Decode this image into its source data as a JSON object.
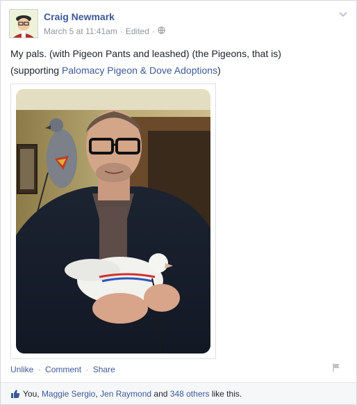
{
  "post": {
    "author": "Craig Newmark",
    "timestamp": "March 5 at 11:41am",
    "edited": "Edited",
    "meta_sep": "·",
    "line1": "My pals. (with Pigeon Pants and leashed) (the Pigeons, that is)",
    "line2_prefix": "(supporting ",
    "line2_link": "Palomacy Pigeon & Dove Adoptions",
    "line2_suffix": ")"
  },
  "actions": {
    "unlike": "Unlike",
    "comment": "Comment",
    "share": "Share",
    "sep": "·"
  },
  "likes": {
    "you": "You,",
    "name1": "Maggie Sergio",
    "sep": ",",
    "name2": "Jen Raymond",
    "and": "and",
    "others": "348 others",
    "tail": "like this."
  },
  "colors": {
    "link": "#3b5998",
    "meta": "#90949c"
  }
}
